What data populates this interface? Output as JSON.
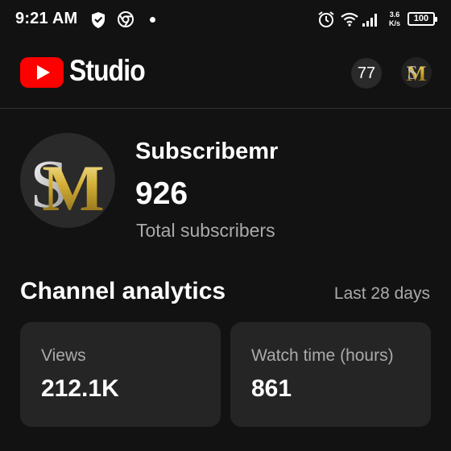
{
  "status_bar": {
    "time": "9:21 AM",
    "speed_value": "3.6",
    "speed_unit": "K/s",
    "battery": "100",
    "icons": [
      "shield-icon",
      "chrome-icon",
      "notification-dot-icon",
      "alarm-icon",
      "wifi-icon",
      "signal-icon",
      "battery-icon"
    ]
  },
  "app_bar": {
    "brand": "Studio",
    "notification_count": "77",
    "brand_color": "#FF0000"
  },
  "channel": {
    "name": "Subscribemr",
    "subscriber_count": "926",
    "subscriber_label": "Total subscribers",
    "avatar_letters": "SM"
  },
  "analytics": {
    "title": "Channel analytics",
    "range": "Last 28 days",
    "cards": [
      {
        "label": "Views",
        "value": "212.1K"
      },
      {
        "label": "Watch time (hours)",
        "value": "861"
      }
    ]
  },
  "colors": {
    "background": "#121212",
    "card": "#252525",
    "secondary_text": "#AAAAAA",
    "gold": "#D4AF37"
  }
}
